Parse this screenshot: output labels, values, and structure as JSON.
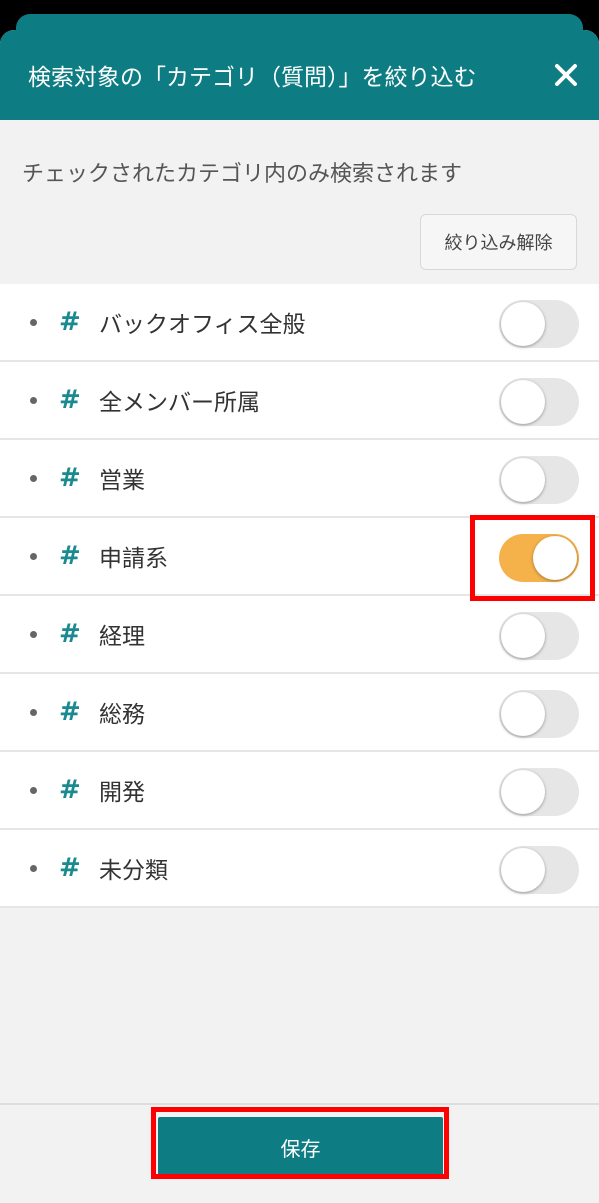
{
  "header": {
    "title": "検索対象の「カテゴリ（質問）」を絞り込む"
  },
  "hint": "チェックされたカテゴリ内のみ検索されます",
  "clear_button": "絞り込み解除",
  "hash_symbol": "#",
  "categories": [
    {
      "label": "バックオフィス全般",
      "enabled": false
    },
    {
      "label": "全メンバー所属",
      "enabled": false
    },
    {
      "label": "営業",
      "enabled": false
    },
    {
      "label": "申請系",
      "enabled": true
    },
    {
      "label": "経理",
      "enabled": false
    },
    {
      "label": "総務",
      "enabled": false
    },
    {
      "label": "開発",
      "enabled": false
    },
    {
      "label": "未分類",
      "enabled": false
    }
  ],
  "save_button": "保存",
  "colors": {
    "primary": "#0e7d83",
    "toggle_on": "#f5b14a",
    "toggle_off": "#e6e6e6",
    "highlight": "#ff0000"
  }
}
